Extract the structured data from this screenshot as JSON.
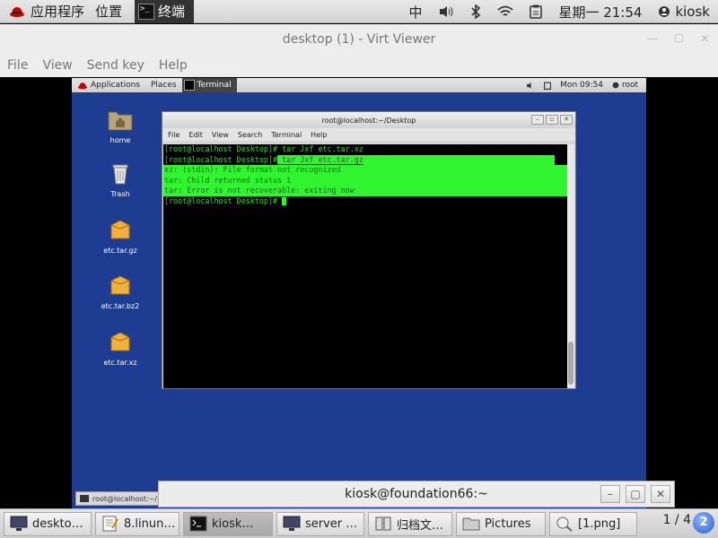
{
  "host_panel": {
    "applications": "应用程序",
    "places": "位置",
    "terminal_tab": "终端",
    "input_method": "中",
    "clock": "星期一 21:54",
    "user": "kiosk"
  },
  "virt_viewer": {
    "title": "desktop (1) - Virt Viewer",
    "menu": [
      "File",
      "View",
      "Send key",
      "Help"
    ]
  },
  "guest": {
    "panel": {
      "applications": "Applications",
      "places": "Places",
      "terminal_tab": "Terminal",
      "clock": "Mon 09:54",
      "user": "root"
    },
    "desktop_icons": [
      {
        "label": "home",
        "icon": "folder-home-icon"
      },
      {
        "label": "Trash",
        "icon": "trash-icon"
      },
      {
        "label": "etc.tar.gz",
        "icon": "archive-icon"
      },
      {
        "label": "etc.tar.bz2",
        "icon": "archive-icon"
      },
      {
        "label": "etc.tar.xz",
        "icon": "archive-icon"
      }
    ],
    "terminal": {
      "title": "root@localhost:~/Desktop",
      "menu": [
        "File",
        "Edit",
        "View",
        "Search",
        "Terminal",
        "Help"
      ],
      "lines": [
        {
          "prompt": "[root@localhost Desktop]#",
          "cmd": " tar Jxf etc.tar.xz"
        },
        {
          "prompt": "[root@localhost Desktop]#",
          "cmd": " tar Jxf etc.tar.gz"
        },
        {
          "text": "xz: (stdin): File format not recognized"
        },
        {
          "text": "tar: Child returned status 1"
        },
        {
          "text": "tar: Error is not recoverable: exiting now"
        },
        {
          "prompt": "[root@localhost Desktop]#",
          "cmd": " "
        }
      ]
    },
    "taskbar_item": "root@localhost:~/"
  },
  "notification_window": {
    "title": "kiosk@foundation66:~"
  },
  "host_taskbar": {
    "items": [
      {
        "label": "deskto…",
        "icon": "monitor-icon"
      },
      {
        "label": "8.linun…",
        "icon": "text-editor-icon"
      },
      {
        "label": "kiosk…",
        "icon": "terminal-icon"
      },
      {
        "label": "server …",
        "icon": "monitor-icon"
      },
      {
        "label": "归档文…",
        "icon": "archive-manager-icon"
      },
      {
        "label": "Pictures",
        "icon": "folder-icon"
      },
      {
        "label": "[1.png]",
        "icon": "image-viewer-icon"
      }
    ],
    "pager": "1 / 4"
  },
  "colors": {
    "guest_desktop": "#1e3d92",
    "terminal_green": "#3ad13a",
    "selection_green": "#31f431"
  }
}
